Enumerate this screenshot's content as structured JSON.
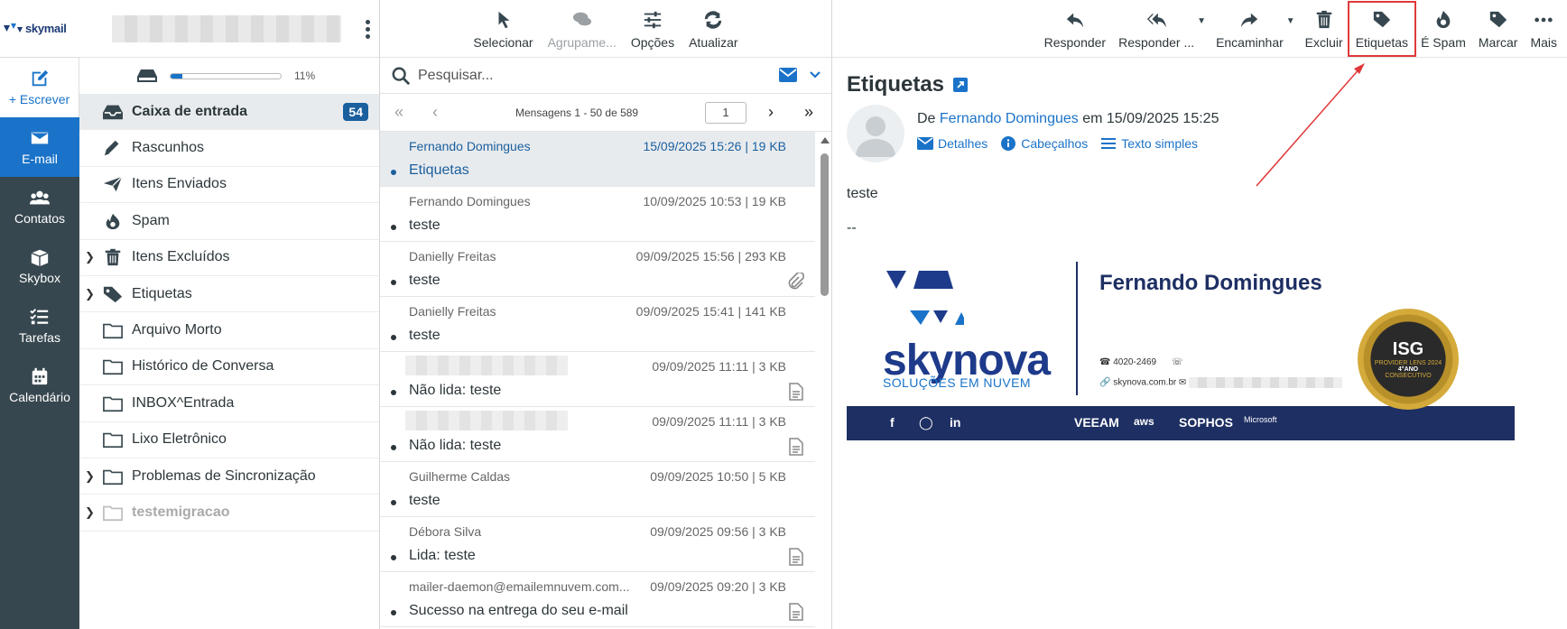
{
  "brand": {
    "logo_text": "skymail"
  },
  "nav": {
    "compose": "+ Escrever",
    "email": "E-mail",
    "contacts": "Contatos",
    "skybox": "Skybox",
    "tasks": "Tarefas",
    "calendar": "Calendário"
  },
  "quota": {
    "percent_label": "11%",
    "fraction": 0.11
  },
  "folders": [
    {
      "label": "Caixa de entrada",
      "badge": "54"
    },
    {
      "label": "Rascunhos"
    },
    {
      "label": "Itens Enviados"
    },
    {
      "label": "Spam"
    },
    {
      "label": "Itens Excluídos"
    },
    {
      "label": "Etiquetas"
    },
    {
      "label": "Arquivo Morto"
    },
    {
      "label": "Histórico de Conversa"
    },
    {
      "label": "INBOX^Entrada"
    },
    {
      "label": "Lixo Eletrônico"
    },
    {
      "label": "Problemas de Sincronização"
    },
    {
      "label": "testemigracao"
    }
  ],
  "list_toolbar": {
    "select": "Selecionar",
    "group": "Agrupame...",
    "options": "Opções",
    "refresh": "Atualizar"
  },
  "search": {
    "placeholder": "Pesquisar..."
  },
  "pager": {
    "count": "Mensagens 1 - 50 de 589",
    "page": "1"
  },
  "messages": [
    {
      "from": "Fernando Domingues",
      "meta": "15/09/2025 15:26 | 19 KB",
      "subject": "Etiquetas"
    },
    {
      "from": "Fernando Domingues",
      "meta": "10/09/2025 10:53 | 19 KB",
      "subject": "teste"
    },
    {
      "from": "Danielly Freitas",
      "meta": "09/09/2025 15:56 | 293 KB",
      "subject": "teste"
    },
    {
      "from": "Danielly Freitas",
      "meta": "09/09/2025 15:41 | 141 KB",
      "subject": "teste"
    },
    {
      "from": "",
      "meta": "09/09/2025 11:11 | 3 KB",
      "subject": "Não lida: teste"
    },
    {
      "from": "",
      "meta": "09/09/2025 11:11 | 3 KB",
      "subject": "Não lida: teste"
    },
    {
      "from": "Guilherme Caldas",
      "meta": "09/09/2025 10:50 | 5 KB",
      "subject": "teste"
    },
    {
      "from": "Débora Silva",
      "meta": "09/09/2025 09:56 | 3 KB",
      "subject": "Lida: teste"
    },
    {
      "from": "mailer-daemon@emailemnuvem.com...",
      "meta": "09/09/2025 09:20 | 3 KB",
      "subject": "Sucesso na entrega do seu e-mail"
    }
  ],
  "reader_toolbar": {
    "reply": "Responder",
    "reply_all": "Responder ...",
    "forward": "Encaminhar",
    "delete": "Excluir",
    "labels": "Etiquetas",
    "spam": "É Spam",
    "mark": "Marcar",
    "more": "Mais"
  },
  "email": {
    "subject": "Etiquetas",
    "from_prefix": "De",
    "from_name": "Fernando Domingues",
    "date_text": "em 15/09/2025 15:25",
    "links": {
      "details": "Detalhes",
      "headers": "Cabeçalhos",
      "plain": "Texto simples"
    },
    "body": "teste",
    "sig_sep": "--"
  },
  "signature": {
    "name": "Fernando Domingues",
    "company": "skynova",
    "tagline": "SOLUÇÕES EM NUVEM",
    "phone": "4020-2469",
    "site": "skynova.com.br",
    "seal_main": "ISG",
    "seal_sub": "PROVIDER LENS 2024",
    "seal_year": "4°ANO",
    "seal_foot": "CONSECUTIVO",
    "partners": [
      "VEEAM",
      "aws",
      "SOPHOS",
      "Microsoft"
    ]
  },
  "colors": {
    "accent": "#1a73c8",
    "nav_bg": "#37474f",
    "highlight_box": "#e0393a",
    "signature_navy": "#1e2f63"
  }
}
